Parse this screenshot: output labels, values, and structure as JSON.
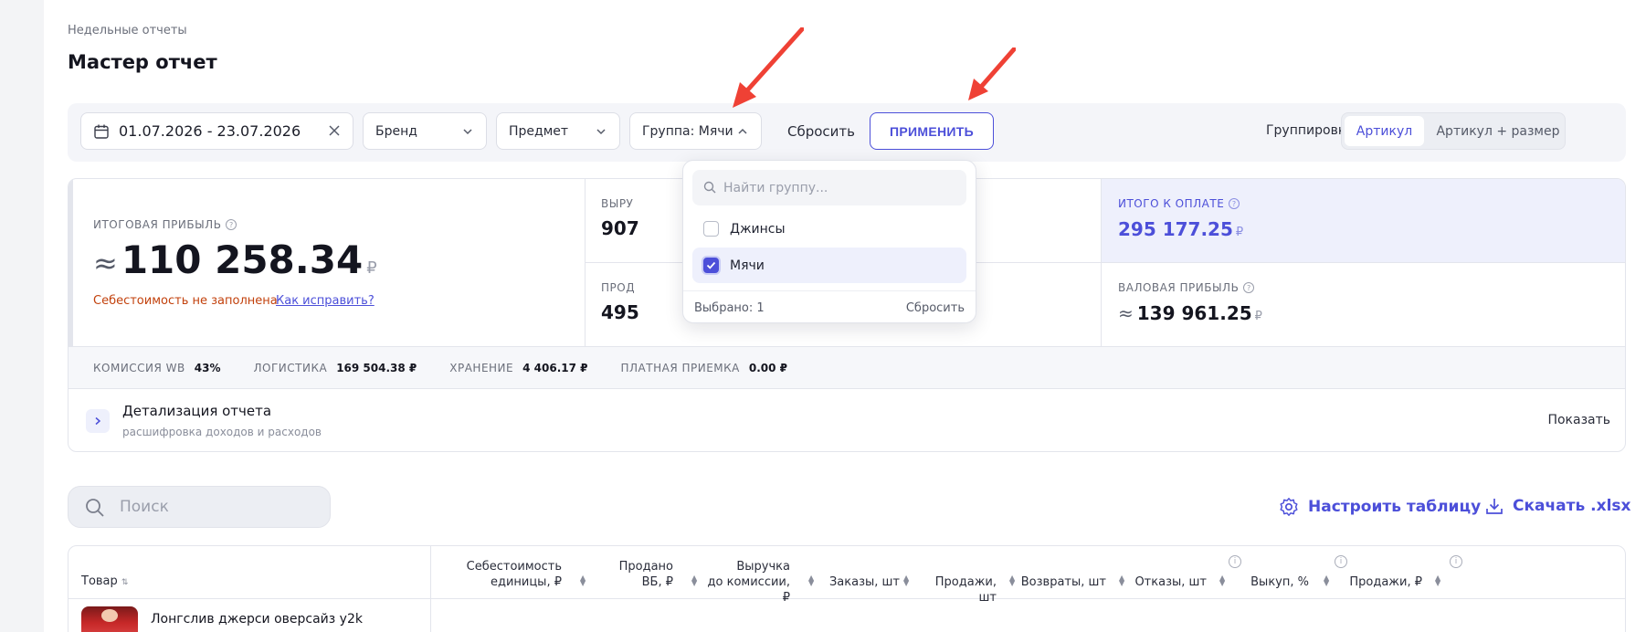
{
  "header": {
    "breadcrumb": "Недельные отчеты",
    "title": "Мастер отчет"
  },
  "filters": {
    "date_range": "01.07.2026 - 23.07.2026",
    "brand": "Бренд",
    "subject": "Предмет",
    "group": "Группа: Мячи",
    "reset_label": "Сбросить",
    "apply_label": "ПРИМЕНИТЬ",
    "grouping_label": "Группировка",
    "grouping_options": [
      "Артикул",
      "Артикул + размер"
    ],
    "grouping_selected": "Артикул"
  },
  "group_dropdown": {
    "search_placeholder": "Найти группу...",
    "options": [
      {
        "label": "Джинсы",
        "checked": false
      },
      {
        "label": "Мячи",
        "checked": true
      }
    ],
    "selected_count": "Выбрано: 1",
    "reset_label": "Сбросить"
  },
  "metrics": {
    "total_profit": {
      "label": "ИТОГОВАЯ ПРИБЫЛЬ",
      "approx": "≈",
      "value": "110 258.34",
      "currency": "₽"
    },
    "cost_warning": "Себестоимость не заполнена",
    "fix_link": "Как исправить?",
    "revenue": {
      "label": "ВЫРУ",
      "value": "907"
    },
    "sales": {
      "label": "ПРОД",
      "value": "495"
    },
    "to_pay": {
      "label": "ИТОГО К ОПЛАТЕ",
      "value": "295 177.25",
      "currency": "₽"
    },
    "gross_profit": {
      "label": "ВАЛОВАЯ ПРИБЫЛЬ",
      "approx": "≈",
      "value": "139 961.25",
      "currency": "₽"
    },
    "colors": {
      "accent": "#4c4fd9",
      "warning": "#c2410c"
    }
  },
  "stats": [
    {
      "key": "КОМИССИЯ WB",
      "value": "43%"
    },
    {
      "key": "ЛОГИСТИКА",
      "value": "169 504.38 ₽"
    },
    {
      "key": "ХРАНЕНИЕ",
      "value": "4 406.17 ₽"
    },
    {
      "key": "ПЛАТНАЯ ПРИЕМКА",
      "value": "0.00 ₽"
    }
  ],
  "details": {
    "title": "Детализация отчета",
    "subtitle": "расшифровка доходов и расходов",
    "show_label": "Показать"
  },
  "toolbar": {
    "search_placeholder": "Поиск",
    "configure_label": "Настроить таблицу",
    "download_label": "Скачать .xlsx"
  },
  "table": {
    "columns": [
      "Товар",
      "Себестоимость\nединицы, ₽",
      "Продано\nВБ, ₽",
      "Выручка\nдо комиссии, ₽",
      "Заказы, шт",
      "Продажи, шт",
      "Возвраты, шт",
      "Отказы, шт",
      "Выкуп, %",
      "Продажи, ₽"
    ],
    "rows": [
      {
        "product": "Лонгслив джерси оверсайз y2k"
      }
    ]
  },
  "icons": [
    "calendar-icon",
    "clear-icon",
    "chevron-down-icon",
    "chevron-up-icon",
    "question-icon",
    "chevron-right-icon",
    "search-icon",
    "gear-icon",
    "download-icon",
    "info-icon",
    "sort-icon",
    "check-icon",
    "arrow-annotation"
  ]
}
